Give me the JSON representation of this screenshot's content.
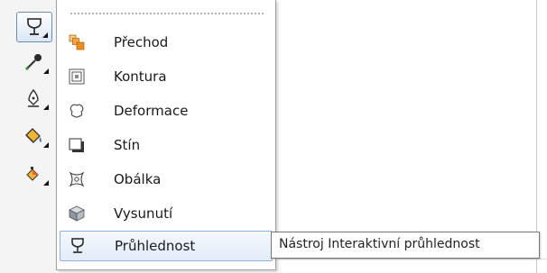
{
  "toolbox": {
    "tools": [
      {
        "icon": "transparency-glass-icon",
        "active": true
      },
      {
        "icon": "eyedropper-icon"
      },
      {
        "icon": "pen-nib-icon"
      },
      {
        "icon": "fill-bucket-icon"
      },
      {
        "icon": "interactive-fill-icon"
      }
    ]
  },
  "flyout": {
    "items": [
      {
        "label": "Přechod",
        "icon": "blend-icon"
      },
      {
        "label": "Kontura",
        "icon": "contour-icon"
      },
      {
        "label": "Deformace",
        "icon": "distort-icon"
      },
      {
        "label": "Stín",
        "icon": "drop-shadow-icon"
      },
      {
        "label": "Obálka",
        "icon": "envelope-icon"
      },
      {
        "label": "Vysunutí",
        "icon": "extrude-icon"
      },
      {
        "label": "Průhlednost",
        "icon": "transparency-icon",
        "selected": true
      }
    ]
  },
  "tooltip": {
    "text": "Nástroj Interaktivní průhlednost"
  },
  "colors": {
    "selection_border": "#8db2e3",
    "selection_fill": "#e2ecf8",
    "blend_orange": "#f08c1e"
  }
}
